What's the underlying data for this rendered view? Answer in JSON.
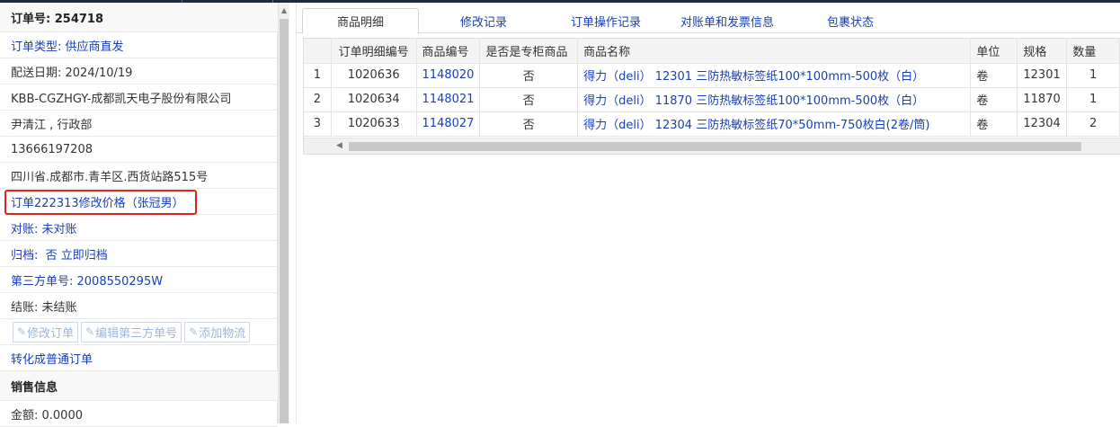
{
  "order": {
    "number_label": "订单号: 254718",
    "type": "订单类型: 供应商直发",
    "delivery_date": "配送日期: 2024/10/19",
    "customer": "KBB-CGZHGY-成都凯天电子股份有限公司",
    "contact": "尹清江 , 行政部",
    "phone": "13666197208",
    "address": "四川省.成都市.青羊区.西货站路515号",
    "change_note": "订单222313修改价格（张冠男）",
    "reconcile": "对账: 未对账",
    "archive_label": "归档:",
    "archive_value": "否 立即归档",
    "third_party": "第三方单号: 2008550295W",
    "settlement": "结账: 未结账",
    "buttons": {
      "edit_order": "修改订单",
      "edit_third_party": "编辑第三方单号",
      "add_logistics": "添加物流"
    },
    "convert": "转化成普通订单"
  },
  "sales": {
    "header": "销售信息",
    "amount": "金额: 0.0000"
  },
  "tabs": [
    "商品明细",
    "修改记录",
    "订单操作记录",
    "对账单和发票信息",
    "包裹状态"
  ],
  "table": {
    "columns": [
      "",
      "订单明细编号",
      "商品编号",
      "是否是专柜商品",
      "商品名称",
      "单位",
      "规格",
      "数量"
    ],
    "rows": [
      {
        "idx": "1",
        "detail_id": "1020636",
        "product_id": "1148020",
        "counter": "否",
        "name": "得力（deli） 12301 三防热敏标签纸100*100mm-500枚（白）",
        "unit": "卷",
        "spec": "12301",
        "qty": "1"
      },
      {
        "idx": "2",
        "detail_id": "1020634",
        "product_id": "1148021",
        "counter": "否",
        "name": "得力（deli） 11870 三防热敏标签纸100*100mm-500枚（白）",
        "unit": "卷",
        "spec": "11870",
        "qty": "1"
      },
      {
        "idx": "3",
        "detail_id": "1020633",
        "product_id": "1148027",
        "counter": "否",
        "name": "得力（deli） 12304 三防热敏标签纸70*50mm-750枚白(2卷/筒)",
        "unit": "卷",
        "spec": "12304",
        "qty": "2"
      }
    ]
  },
  "icons": {
    "edit": "edit-icon",
    "scroll_up": "scroll-up-icon",
    "scroll_left": "scroll-left-icon"
  },
  "colors": {
    "link": "#1a3fb5",
    "highlight_border": "#e2231a"
  }
}
